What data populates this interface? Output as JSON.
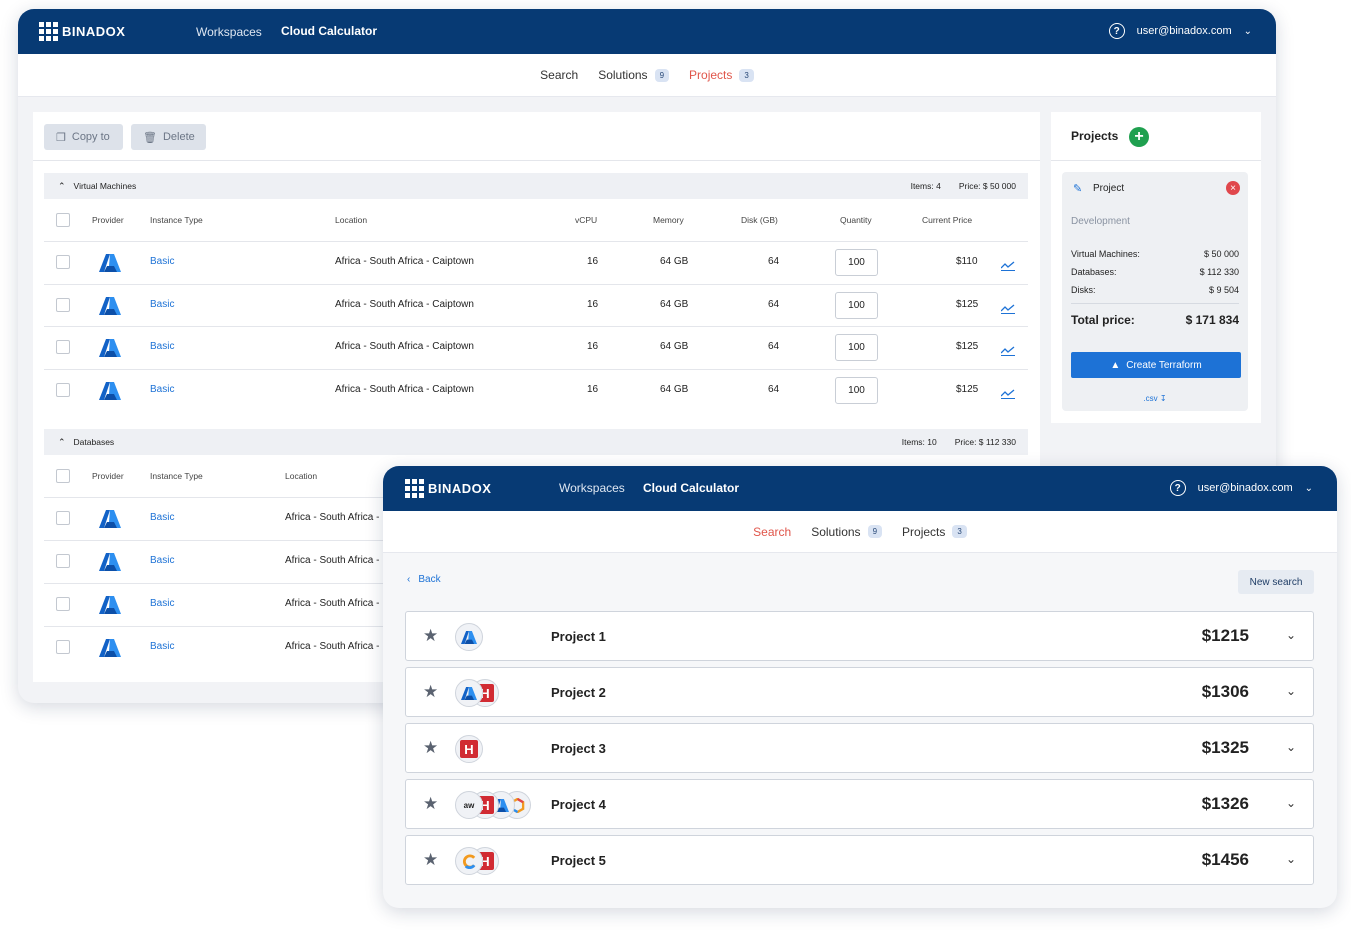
{
  "brand": "BINADOX",
  "nav": {
    "workspaces": "Workspaces",
    "calculator": "Cloud Calculator"
  },
  "user": {
    "help": "?",
    "email": "user@binadox.com"
  },
  "subnav": {
    "search": "Search",
    "solutions": "Solutions",
    "solutions_count": "9",
    "projects": "Projects",
    "projects_count": "3"
  },
  "toolbar": {
    "copy": "Copy to",
    "delete": "Delete"
  },
  "columns": {
    "provider": "Provider",
    "instance_type": "Instance Type",
    "location": "Location",
    "vcpu": "vCPU",
    "memory": "Memory",
    "disk": "Disk (GB)",
    "quantity": "Quantity",
    "price": "Current Price"
  },
  "vm_section": {
    "title": "Virtual Machines",
    "items": "Items: 4",
    "price": "Price: $ 50 000",
    "rows": [
      {
        "type": "Basic",
        "location": "Africa - South Africa - Caiptown",
        "vcpu": "16",
        "memory": "64 GB",
        "disk": "64",
        "qty": "100",
        "price": "$110"
      },
      {
        "type": "Basic",
        "location": "Africa - South Africa - Caiptown",
        "vcpu": "16",
        "memory": "64 GB",
        "disk": "64",
        "qty": "100",
        "price": "$125"
      },
      {
        "type": "Basic",
        "location": "Africa - South Africa - Caiptown",
        "vcpu": "16",
        "memory": "64 GB",
        "disk": "64",
        "qty": "100",
        "price": "$125"
      },
      {
        "type": "Basic",
        "location": "Africa - South Africa - Caiptown",
        "vcpu": "16",
        "memory": "64 GB",
        "disk": "64",
        "qty": "100",
        "price": "$125"
      }
    ]
  },
  "db_section": {
    "title": "Databases",
    "items": "Items: 10",
    "price": "Price: $ 112 330",
    "rows": [
      {
        "type": "Basic",
        "location": "Africa - South Africa -"
      },
      {
        "type": "Basic",
        "location": "Africa - South Africa -"
      },
      {
        "type": "Basic",
        "location": "Africa - South Africa -"
      },
      {
        "type": "Basic",
        "location": "Africa - South Africa -"
      }
    ]
  },
  "projects_panel": {
    "title": "Projects",
    "card": {
      "name": "Project",
      "env": "Development",
      "vm_label": "Virtual Machines:",
      "vm_value": "$ 50 000",
      "db_label": "Databases:",
      "db_value": "$ 112 330",
      "disk_label": "Disks:",
      "disk_value": "$ 9 504",
      "total_label": "Total price:",
      "total_value": "$ 171 834",
      "terraform": "Create Terraform",
      "csv": ".csv"
    }
  },
  "search_view": {
    "back": "Back",
    "new_search": "New search",
    "projects": [
      {
        "name": "Project 1",
        "price": "$1215"
      },
      {
        "name": "Project 2",
        "price": "$1306"
      },
      {
        "name": "Project 3",
        "price": "$1325"
      },
      {
        "name": "Project 4",
        "price": "$1326"
      },
      {
        "name": "Project 5",
        "price": "$1456"
      }
    ]
  },
  "colors": {
    "navy": "#073a74",
    "accent_blue": "#1d72d6",
    "active_red": "#e0554a",
    "add_green": "#1fa04f",
    "remove_red": "#e0474c",
    "hashicorp_red": "#d12b33"
  }
}
